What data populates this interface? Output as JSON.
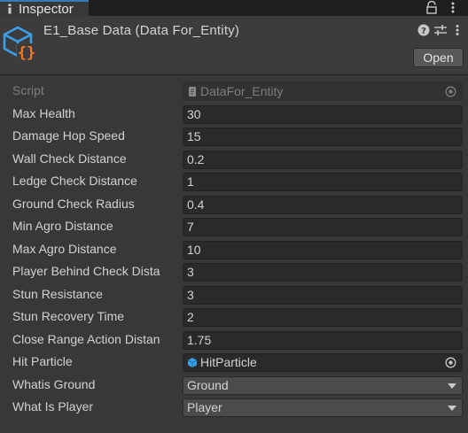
{
  "tab": {
    "label": "Inspector"
  },
  "header": {
    "title": "E1_Base Data (Data For_Entity)",
    "open_button": "Open"
  },
  "properties": [
    {
      "label": "Script",
      "value": "DataFor_Entity",
      "kind": "object",
      "disabled": true,
      "icon": "script-icon"
    },
    {
      "label": "Max Health",
      "value": "30",
      "kind": "number"
    },
    {
      "label": "Damage Hop Speed",
      "value": "15",
      "kind": "number"
    },
    {
      "label": "Wall Check Distance",
      "value": "0.2",
      "kind": "number"
    },
    {
      "label": "Ledge Check Distance",
      "value": "1",
      "kind": "number"
    },
    {
      "label": "Ground Check Radius",
      "value": "0.4",
      "kind": "number"
    },
    {
      "label": "Min Agro Distance",
      "value": "7",
      "kind": "number"
    },
    {
      "label": "Max Agro Distance",
      "value": "10",
      "kind": "number"
    },
    {
      "label": "Player Behind Check Dista",
      "value": "3",
      "kind": "number"
    },
    {
      "label": "Stun Resistance",
      "value": "3",
      "kind": "number"
    },
    {
      "label": "Stun Recovery Time",
      "value": "2",
      "kind": "number"
    },
    {
      "label": "Close Range Action Distan",
      "value": "1.75",
      "kind": "number"
    },
    {
      "label": "Hit Particle",
      "value": "HitParticle",
      "kind": "object",
      "icon": "prefab-icon"
    },
    {
      "label": "Whatis Ground",
      "value": "Ground",
      "kind": "dropdown"
    },
    {
      "label": "What Is Player",
      "value": "Player",
      "kind": "dropdown"
    }
  ],
  "colors": {
    "background": "#383838",
    "field": "#2a2a2a",
    "tab_accent": "#3a79bb",
    "asset_icon_blue": "#3aa0e8",
    "asset_icon_orange": "#ef7b2b"
  }
}
